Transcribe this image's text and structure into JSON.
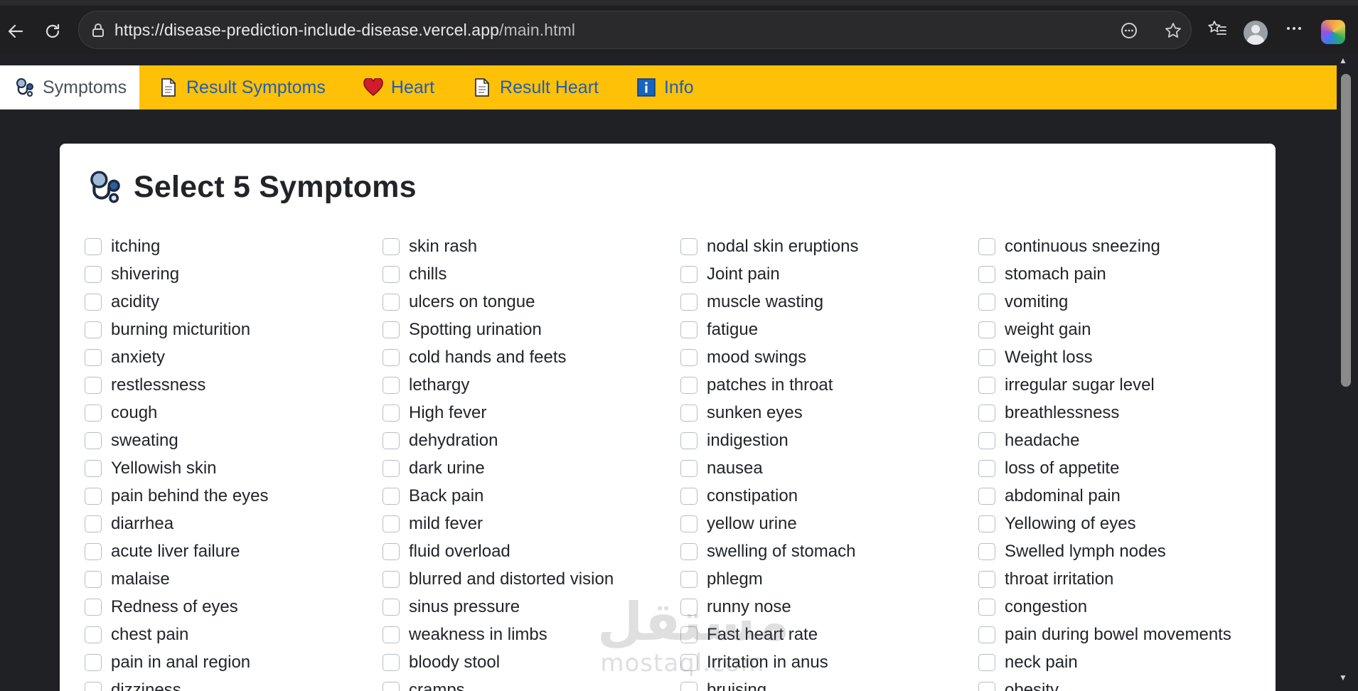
{
  "browser": {
    "url_host": "https://disease-prediction-include-disease.vercel.app",
    "url_path": "/main.html"
  },
  "tabs": [
    {
      "label": "Symptoms",
      "icon": "stethoscope-icon",
      "active": true
    },
    {
      "label": "Result Symptoms",
      "icon": "document-icon",
      "active": false
    },
    {
      "label": "Heart",
      "icon": "heart-icon",
      "active": false
    },
    {
      "label": "Result Heart",
      "icon": "document-icon",
      "active": false
    },
    {
      "label": "Info",
      "icon": "info-icon",
      "active": false
    }
  ],
  "card": {
    "title": "Select 5 Symptoms"
  },
  "symptoms": [
    "itching",
    "skin rash",
    "nodal skin eruptions",
    "continuous sneezing",
    "shivering",
    "chills",
    "Joint pain",
    "stomach pain",
    "acidity",
    "ulcers on tongue",
    "muscle wasting",
    "vomiting",
    "burning micturition",
    "Spotting urination",
    "fatigue",
    "weight gain",
    "anxiety",
    "cold hands and feets",
    "mood swings",
    "Weight loss",
    "restlessness",
    "lethargy",
    "patches in throat",
    "irregular sugar level",
    "cough",
    "High fever",
    "sunken eyes",
    "breathlessness",
    "sweating",
    "dehydration",
    "indigestion",
    "headache",
    "Yellowish skin",
    "dark urine",
    "nausea",
    "loss of appetite",
    "pain behind the eyes",
    "Back pain",
    "constipation",
    "abdominal pain",
    "diarrhea",
    "mild fever",
    "yellow urine",
    "Yellowing of eyes",
    "acute liver failure",
    "fluid overload",
    "swelling of stomach",
    "Swelled lymph nodes",
    "malaise",
    "blurred and distorted vision",
    "phlegm",
    "throat irritation",
    "Redness of eyes",
    "sinus pressure",
    "runny nose",
    "congestion",
    "chest pain",
    "weakness in limbs",
    "Fast heart rate",
    "pain during bowel movements",
    "pain in anal region",
    "bloody stool",
    "Irritation in anus",
    "neck pain",
    "dizziness",
    "cramps",
    "bruising",
    "obesity"
  ],
  "watermark": {
    "arabic": "مستقل",
    "latin": "mostaql.com"
  },
  "colors": {
    "tabbar": "#ffc107",
    "tab_link": "#1e5eb8",
    "page_bg": "#202124"
  }
}
